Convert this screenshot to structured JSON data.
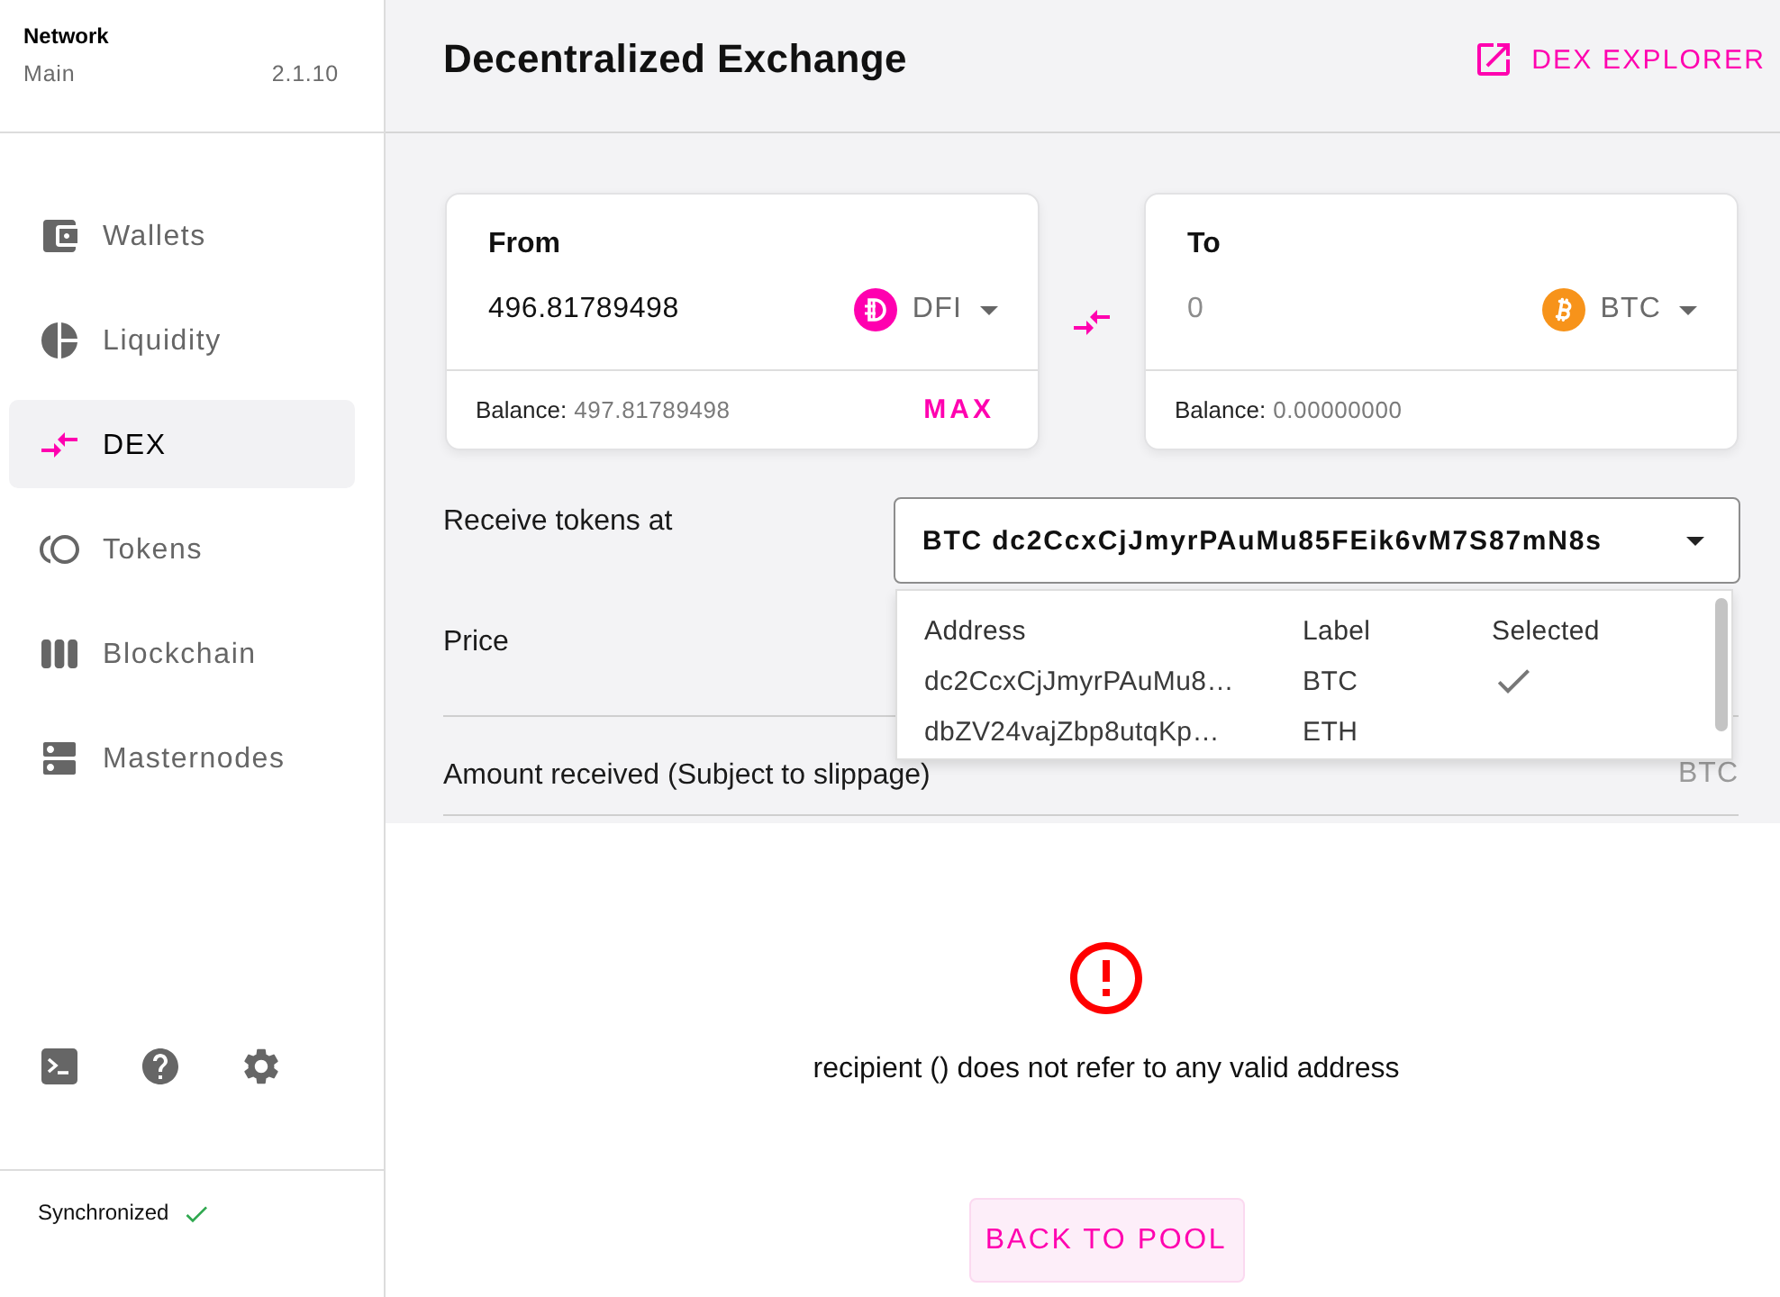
{
  "sidebar": {
    "network_label": "Network",
    "network": "Main",
    "version": "2.1.10",
    "items": [
      {
        "label": "Wallets",
        "selected": false
      },
      {
        "label": "Liquidity",
        "selected": false
      },
      {
        "label": "DEX",
        "selected": true
      },
      {
        "label": "Tokens",
        "selected": false
      },
      {
        "label": "Blockchain",
        "selected": false
      },
      {
        "label": "Masternodes",
        "selected": false
      }
    ],
    "sync": {
      "label": "Synchronized",
      "synced": true
    }
  },
  "header": {
    "title": "Decentralized Exchange",
    "link": "DEX EXPLORER"
  },
  "from_card": {
    "label": "From",
    "value": "496.81789498",
    "token": "DFI",
    "balance_label": "Balance:",
    "balance": "497.81789498",
    "max": "MAX"
  },
  "to_card": {
    "label": "To",
    "placeholder": "0",
    "token": "BTC",
    "balance_label": "Balance:",
    "balance": "0.00000000"
  },
  "receive": {
    "label": "Receive tokens at",
    "value": "BTC dc2CcxCjJmyrPAuMu85FEik6vM7S87mN8s",
    "expanded": true,
    "menu": {
      "columns": [
        "Address",
        "Label",
        "Selected"
      ],
      "rows": [
        {
          "address": "dc2CcxCjJmyrPAuMu8…",
          "label": "BTC",
          "selected": true
        },
        {
          "address": "dbZV24vajZbp8utqKp…",
          "label": "ETH",
          "selected": false
        }
      ]
    }
  },
  "price": {
    "label": "Price"
  },
  "amount_received": {
    "label": "Amount received (Subject to slippage)",
    "unit": "BTC"
  },
  "error": {
    "message": "recipient () does not refer to any valid address",
    "button": "BACK TO POOL"
  }
}
